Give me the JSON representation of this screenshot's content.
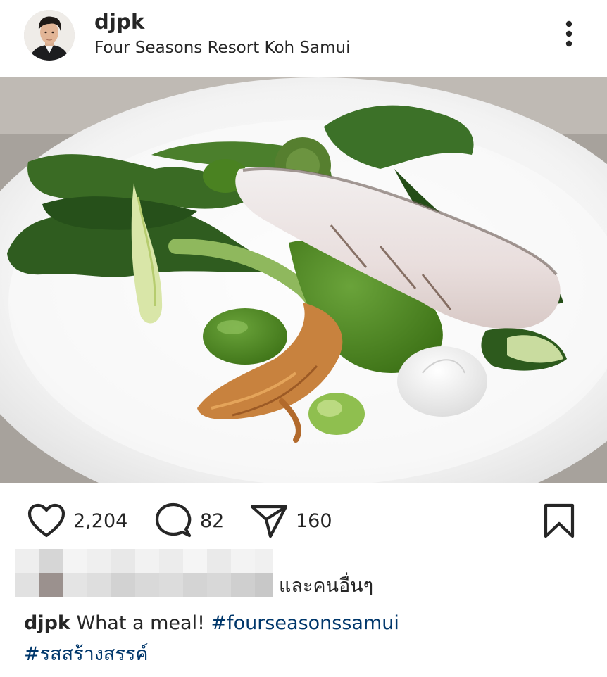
{
  "post": {
    "username": "djpk",
    "location": "Four Seasons Resort Koh Samui"
  },
  "actions": {
    "likes": "2,204",
    "comments": "82",
    "shares": "160"
  },
  "liked_by": {
    "suffix": "และคนอื่นๆ"
  },
  "caption": {
    "username": "djpk",
    "text": "What a meal!",
    "hashtags": [
      "#fourseasonssamui",
      "#รสสร้างสรรค์"
    ]
  },
  "colors": {
    "text": "#262626",
    "hashtag": "#00376b",
    "sauce_green": "#4f8a23"
  },
  "icons": {
    "more": "more-vertical-icon",
    "like": "heart-icon",
    "comment": "comment-icon",
    "share": "send-icon",
    "save": "bookmark-icon"
  }
}
